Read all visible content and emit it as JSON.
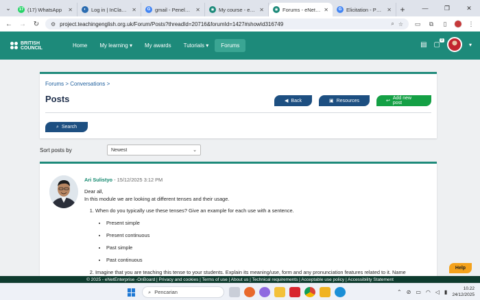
{
  "browser": {
    "tabs": [
      {
        "title": "(17) WhatsApp",
        "favicon_color": "#25d366",
        "favicon_glyph": "17"
      },
      {
        "title": "Log in | InClass.British",
        "favicon_color": "#2b6cb0",
        "favicon_glyph": "◐"
      },
      {
        "title": "gmail - Penelusuran",
        "favicon_color": "#4285f4",
        "favicon_glyph": "G"
      },
      {
        "title": "My course - eNetEnt",
        "favicon_color": "#1d8a7a",
        "favicon_glyph": "✱"
      },
      {
        "title": "Forums - eNetEnterp",
        "favicon_color": "#1d8a7a",
        "favicon_glyph": "✱"
      },
      {
        "title": "Elicitation - Penelusur",
        "favicon_color": "#4285f4",
        "favicon_glyph": "G"
      }
    ],
    "url": "project.teachingenglish.org.uk/Forum/Posts?threadId=20716&forumId=1427#showId316749"
  },
  "site": {
    "logo_line1": "BRITISH",
    "logo_line2": "COUNCIL",
    "nav": [
      "Home",
      "My learning",
      "My awards",
      "Tutorials",
      "Forums"
    ],
    "notification_count": "0"
  },
  "header_card": {
    "breadcrumb": "Forums > Conversations >",
    "title": "Posts",
    "back_label": "Back",
    "resources_label": "Resources",
    "add_post_label": "Add new post",
    "search_label": "Search"
  },
  "sort": {
    "label": "Sort posts by",
    "selected": "Newest"
  },
  "post": {
    "author": "Ari Sulistyo",
    "meta": " - 15/12/2025 3:12 PM",
    "greeting": "Dear all,",
    "intro": "In this module we are looking at different tenses and their usage.",
    "q1": "When do you typically use these tenses? Give an example for each use with a sentence.",
    "tenses": [
      "Present simple",
      "Present continuous",
      "Past simple",
      "Past continuous"
    ],
    "q2": "Imagine that you are teaching this tense to your students. Explain its meaning/use, form and any pronunciation features related to it. Name"
  },
  "help_label": "Help",
  "footer_text": "© 2025 - eNetEnterprise -OnBoard | Privacy and cookies | Terms of use | About us | Technical requirements | Acceptable use policy | Accessibility Statement",
  "taskbar": {
    "search_placeholder": "Pencarian",
    "time": "10.22",
    "date": "24/12/2025"
  }
}
